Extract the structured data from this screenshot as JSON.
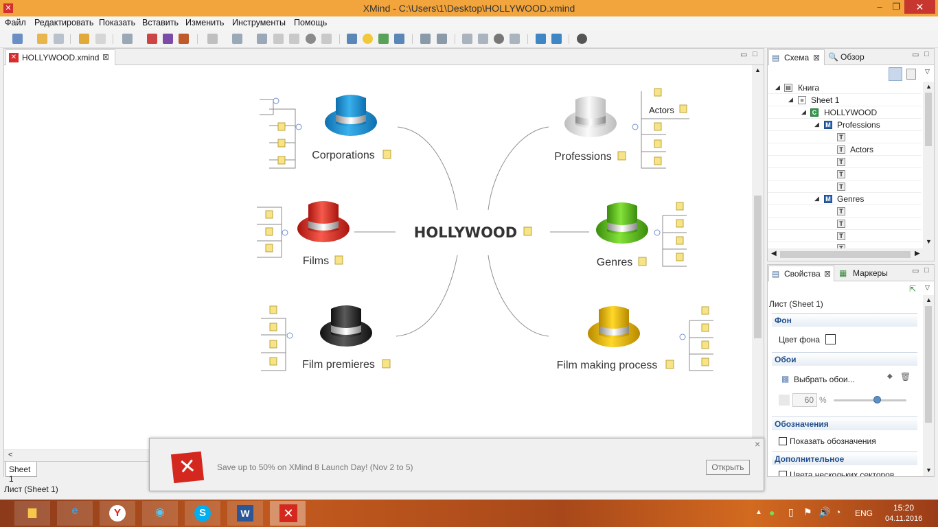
{
  "window": {
    "title": "XMind - C:\\Users\\1\\Desktop\\HOLLYWOOD.xmind",
    "minimize": "–",
    "maximize": "❐",
    "close": "✕"
  },
  "menu": [
    "Файл",
    "Редактировать",
    "Показать",
    "Вставить",
    "Изменить",
    "Инструменты",
    "Помощь"
  ],
  "editor": {
    "tab": "HOLLYWOOD.xmind",
    "sheet_tab": "Sheet 1",
    "scroll_left": "<"
  },
  "mindmap": {
    "central": "HOLLYWOOD",
    "topics": [
      "Corporations",
      "Professions",
      "Films",
      "Genres",
      "Film premieres",
      "Film making process"
    ],
    "subtopic": "Actors"
  },
  "outline": {
    "tabs": [
      "Схема",
      "Обзор"
    ],
    "tree": [
      {
        "label": "Книга",
        "icon": "book-icon"
      },
      {
        "label": "Sheet 1",
        "icon": "sheet-icon"
      },
      {
        "label": "HOLLYWOOD",
        "icon": "central-topic-icon",
        "badge": "C"
      },
      {
        "label": "Professions",
        "icon": "main-topic-icon",
        "badge": "M"
      },
      {
        "label": "",
        "icon": "topic-icon",
        "badge": "T"
      },
      {
        "label": "Actors",
        "icon": "topic-icon",
        "badge": "T"
      },
      {
        "label": "",
        "icon": "topic-icon",
        "badge": "T"
      },
      {
        "label": "",
        "icon": "topic-icon",
        "badge": "T"
      },
      {
        "label": "",
        "icon": "topic-icon",
        "badge": "T"
      },
      {
        "label": "Genres",
        "icon": "main-topic-icon",
        "badge": "M"
      },
      {
        "label": "",
        "icon": "topic-icon",
        "badge": "T"
      },
      {
        "label": "",
        "icon": "topic-icon",
        "badge": "T"
      },
      {
        "label": "",
        "icon": "topic-icon",
        "badge": "T"
      },
      {
        "label": "",
        "icon": "topic-icon",
        "badge": "T"
      }
    ]
  },
  "properties": {
    "tabs": [
      "Свойства",
      "Маркеры"
    ],
    "title": "Лист (Sheet 1)",
    "sec_bg": "Фон",
    "bg_color": "Цвет фона",
    "sec_wall": "Обои",
    "wall_choose": "Выбрать обои...",
    "opacity": "60",
    "percent": "%",
    "sec_legend": "Обозначения",
    "show_legend": "Показать обозначения",
    "sec_adv": "Дополнительное",
    "multi_color": "Цвета нескольких секторов"
  },
  "status": "Лист (Sheet 1)",
  "popup": {
    "message": "Save up to 50% on XMind 8 Launch Day! (Nov 2 to 5)",
    "open": "Открыть",
    "close": "×"
  },
  "tray": {
    "lang": "ENG",
    "time": "15:20",
    "date": "04.11.2016"
  },
  "colors": {
    "hat_blue": "#1e93d3",
    "hat_white": "#e8e8e8",
    "hat_red": "#e23a2e",
    "hat_green": "#58c21c",
    "hat_black": "#2b2b2b",
    "hat_yellow": "#e6b800"
  }
}
